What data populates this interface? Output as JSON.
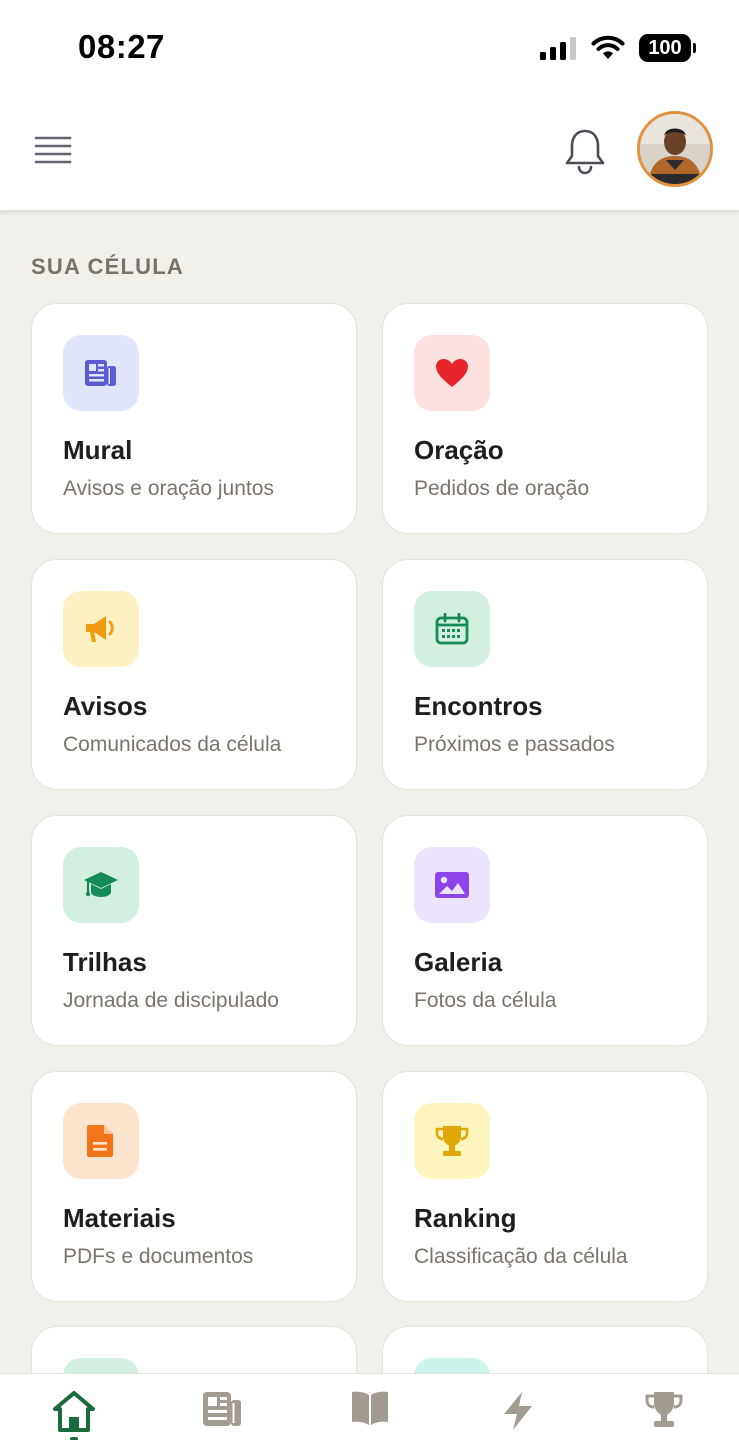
{
  "status_bar": {
    "time": "08:27",
    "battery": "100"
  },
  "header": {
    "menu_icon": "hamburger-menu-icon",
    "bell_icon": "bell-icon",
    "avatar_label": "user-avatar"
  },
  "section": {
    "title": "SUA CÉLULA"
  },
  "cards": [
    {
      "title": "Mural",
      "subtitle": "Avisos e oração juntos",
      "icon": "newspaper-icon",
      "icon_bg": "#e2e6fc",
      "icon_color": "#5b5bd6"
    },
    {
      "title": "Oração",
      "subtitle": "Pedidos de oração",
      "icon": "heart-icon",
      "icon_bg": "#fde1e1",
      "icon_color": "#e5252a"
    },
    {
      "title": "Avisos",
      "subtitle": "Comunicados da célula",
      "icon": "megaphone-icon",
      "icon_bg": "#fdf0c2",
      "icon_color": "#f09a0f"
    },
    {
      "title": "Encontros",
      "subtitle": "Próximos e passados",
      "icon": "calendar-icon",
      "icon_bg": "#d2efdf",
      "icon_color": "#168a57"
    },
    {
      "title": "Trilhas",
      "subtitle": "Jornada de discipulado",
      "icon": "graduation-cap-icon",
      "icon_bg": "#d2efdf",
      "icon_color": "#168a57"
    },
    {
      "title": "Galeria",
      "subtitle": "Fotos da célula",
      "icon": "image-icon",
      "icon_bg": "#ece4fd",
      "icon_color": "#8b45e8"
    },
    {
      "title": "Materiais",
      "subtitle": "PDFs e documentos",
      "icon": "document-icon",
      "icon_bg": "#fde4cf",
      "icon_color": "#f2741b"
    },
    {
      "title": "Ranking",
      "subtitle": "Classificação da célula",
      "icon": "trophy-icon",
      "icon_bg": "#fdf5bd",
      "icon_color": "#e0a70b"
    }
  ],
  "partial_cards": [
    {
      "icon_bg": "#d2efdf"
    },
    {
      "icon_bg": "#cdf4ec"
    }
  ],
  "bottom_nav": {
    "items": [
      {
        "icon": "home-icon",
        "active": true
      },
      {
        "icon": "newspaper-icon",
        "active": false
      },
      {
        "icon": "book-open-icon",
        "active": false
      },
      {
        "icon": "lightning-icon",
        "active": false
      },
      {
        "icon": "trophy-icon",
        "active": false
      }
    ],
    "active_color": "#1a6b3c",
    "inactive_color": "#a19b92"
  }
}
